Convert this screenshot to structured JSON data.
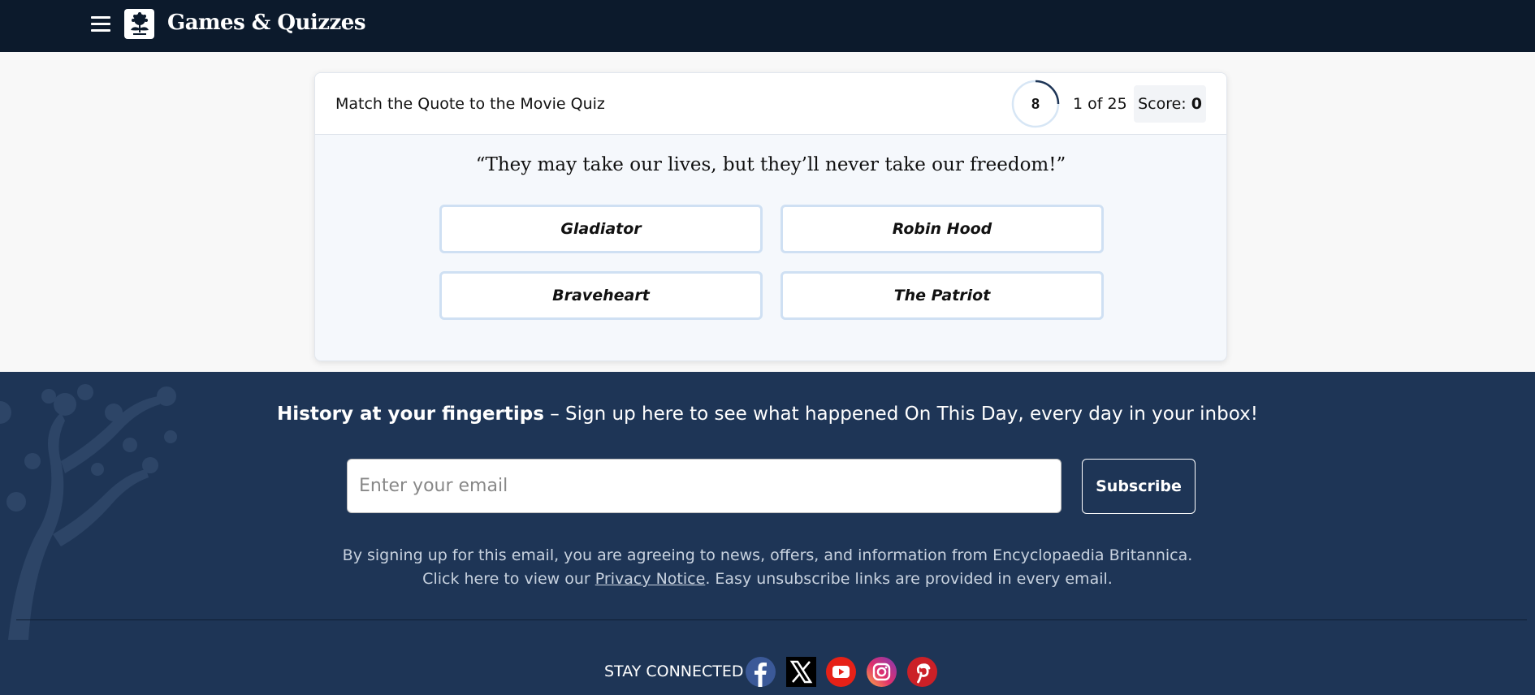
{
  "header": {
    "brand": "Games & Quizzes"
  },
  "quiz": {
    "title": "Match the Quote to the Movie Quiz",
    "timer": "8",
    "progress": "1 of 25",
    "score_label": "Score:",
    "score_value": "0",
    "quote": "“They may take our lives, but they’ll never take our freedom!”",
    "answers": [
      "Gladiator",
      "Robin Hood",
      "Braveheart",
      "The Patriot"
    ]
  },
  "newsletter": {
    "headline_bold": "History at your fingertips",
    "headline_rest": " – Sign up here to see what happened On This Day, every day in your inbox!",
    "email_placeholder": "Enter your email",
    "subscribe_label": "Subscribe",
    "legal_line1": "By signing up for this email, you are agreeing to news, offers, and information from Encyclopaedia Britannica.",
    "legal_line2_pre": "Click here to view our ",
    "privacy_link": "Privacy Notice",
    "legal_line2_post": ". Easy unsubscribe links are provided in every email."
  },
  "footer": {
    "stay_connected": "STAY CONNECTED",
    "social": [
      "facebook-icon",
      "x-icon",
      "youtube-icon",
      "instagram-icon",
      "pinterest-icon"
    ]
  },
  "colors": {
    "topbar": "#0c1a2c",
    "footer": "#1e3556",
    "answer_border": "#cfe0f3"
  }
}
